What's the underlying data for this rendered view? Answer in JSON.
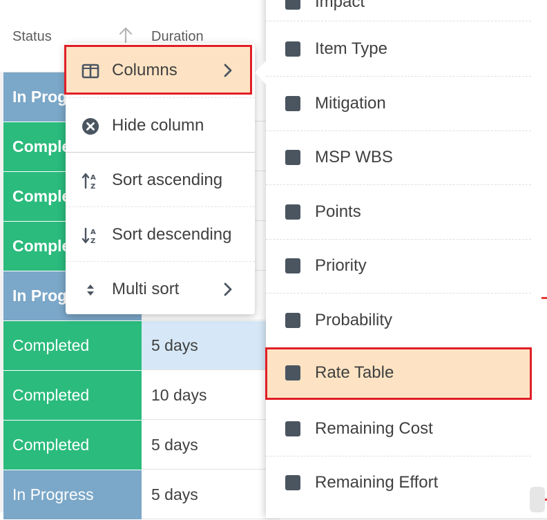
{
  "grid": {
    "header": {
      "status": "Status",
      "duration": "Duration"
    },
    "rows": [
      {
        "status": "In Progress",
        "duration": "",
        "kind": "inprogress",
        "bold": true
      },
      {
        "status": "Completed",
        "duration": "",
        "kind": "completed",
        "bold": true
      },
      {
        "status": "Completed",
        "duration": "",
        "kind": "completed",
        "bold": true
      },
      {
        "status": "Completed",
        "duration": "",
        "kind": "completed",
        "bold": true
      },
      {
        "status": "In Progress",
        "duration": "",
        "kind": "inprogress",
        "bold": true
      },
      {
        "status": "Completed",
        "duration": "5 days",
        "kind": "completed",
        "bold": false,
        "selected": true
      },
      {
        "status": "Completed",
        "duration": "10 days",
        "kind": "completed",
        "bold": false
      },
      {
        "status": "Completed",
        "duration": "5 days",
        "kind": "completed",
        "bold": false
      },
      {
        "status": "In Progress",
        "duration": "5 days",
        "kind": "inprogress",
        "bold": false
      }
    ]
  },
  "context_menu": {
    "items": [
      {
        "label": "Columns",
        "icon": "columns-icon",
        "has_submenu": true,
        "highlighted": true
      },
      {
        "label": "Hide column",
        "icon": "close-circle-icon"
      },
      {
        "label": "Sort ascending",
        "icon": "sort-ascending-icon"
      },
      {
        "label": "Sort descending",
        "icon": "sort-descending-icon"
      },
      {
        "label": "Multi sort",
        "icon": "sort-updown-icon",
        "has_submenu": true
      }
    ]
  },
  "columns_submenu": {
    "items": [
      {
        "label": "Impact"
      },
      {
        "label": "Item Type"
      },
      {
        "label": "Mitigation"
      },
      {
        "label": "MSP WBS"
      },
      {
        "label": "Points"
      },
      {
        "label": "Priority"
      },
      {
        "label": "Probability"
      },
      {
        "label": "Rate Table",
        "highlighted": true
      },
      {
        "label": "Remaining Cost"
      },
      {
        "label": "Remaining Effort"
      }
    ]
  },
  "colors": {
    "completed": "#2bbb7d",
    "in_progress": "#7ba7c8",
    "highlight_fill": "#fde3c3",
    "highlight_border": "#e01e26",
    "checkbox": "#4a5560"
  }
}
